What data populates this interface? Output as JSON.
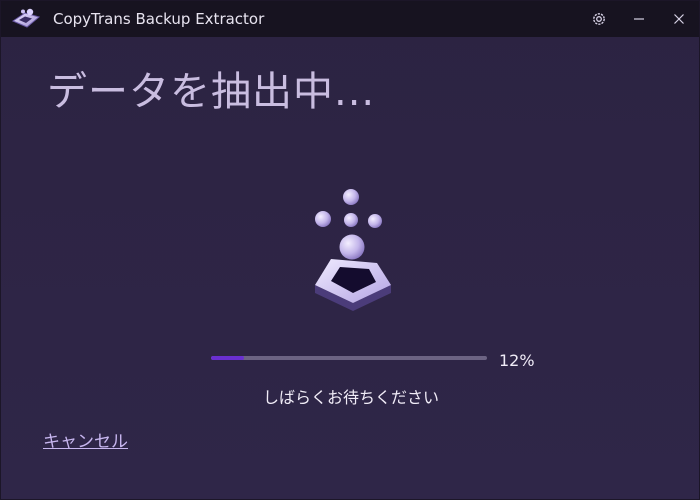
{
  "window": {
    "title": "CopyTrans Backup Extractor",
    "controls": {
      "settings_icon": "gear-icon",
      "minimize_icon": "minimize-icon",
      "close_icon": "close-icon"
    }
  },
  "main": {
    "heading": "データを抽出中...",
    "progress": {
      "value": 0.12,
      "percent_label": "12%"
    },
    "status": "しばらくお待ちください",
    "cancel_label": "キャンセル"
  },
  "colors": {
    "background": "#2d2444",
    "titlebar": "#171320",
    "heading": "#c9bde0",
    "accent": "#6a2fd1",
    "track": "#6c6383",
    "link": "#c7b6ef"
  }
}
